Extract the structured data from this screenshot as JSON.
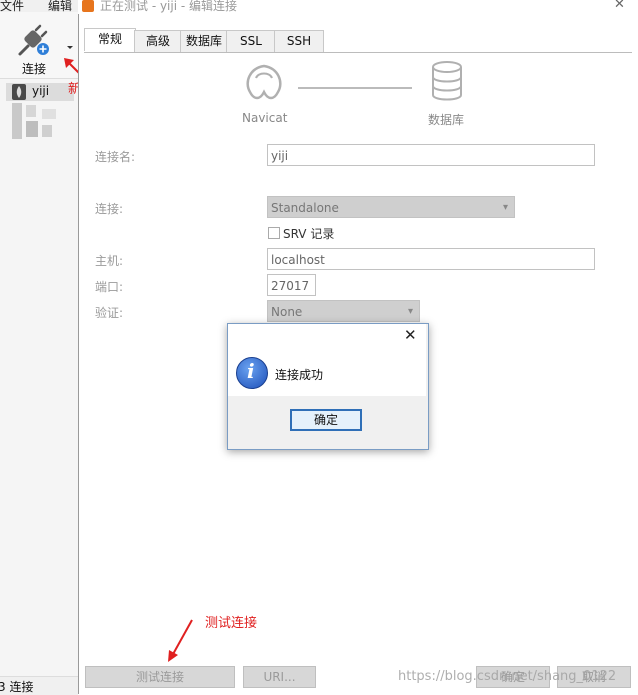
{
  "main_window": {
    "menu": {
      "file": "文件",
      "edit": "编辑"
    },
    "toolbar": {
      "connect_label": "连接"
    },
    "nav": {
      "connection_name": "yiji"
    },
    "status": {
      "text": "3 连接"
    }
  },
  "annotations": {
    "new_connection": "新建连接",
    "test_connection": "测试连接"
  },
  "dialog": {
    "title": "正在测试 - yiji - 编辑连接",
    "tabs": [
      {
        "label": "常规",
        "active": true
      },
      {
        "label": "高级"
      },
      {
        "label": "数据库"
      },
      {
        "label": "SSL"
      },
      {
        "label": "SSH"
      }
    ],
    "graphic": {
      "left_label": "Navicat",
      "right_label": "数据库"
    },
    "fields": {
      "conn_name_label": "连接名:",
      "conn_name_value": "yiji",
      "conn_label": "连接:",
      "conn_value": "Standalone",
      "srv_label": "SRV 记录",
      "host_label": "主机:",
      "host_value": "localhost",
      "port_label": "端口:",
      "port_value": "27017",
      "auth_label": "验证:",
      "auth_value": "None"
    },
    "buttons": {
      "test": "测试连接",
      "uri": "URI...",
      "ok": "确定",
      "cancel": "取消"
    }
  },
  "message_box": {
    "text": "连接成功",
    "ok": "确定"
  },
  "watermark": "https://blog.csdn.net/shang_0122"
}
